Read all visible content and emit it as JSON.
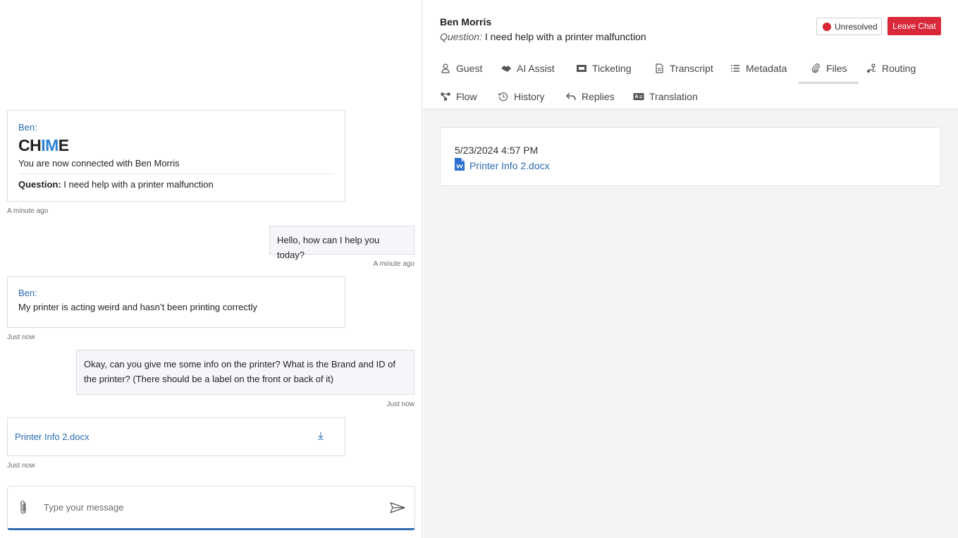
{
  "chat": {
    "connect_card": {
      "sender": "Ben:",
      "logo": {
        "pre": "CH",
        "mid": "IM",
        "post": "E"
      },
      "text": "You are now connected with Ben Morris",
      "question_label": "Question:",
      "question_text": " I need help with a printer malfunction",
      "timestamp": "A minute ago"
    },
    "msg_agent_1": {
      "text": "Hello, how can I help you today?",
      "timestamp": "A minute ago"
    },
    "msg_guest_2": {
      "sender": "Ben:",
      "text": "My printer is acting weird and hasn’t been printing correctly",
      "timestamp": "Just now"
    },
    "msg_agent_2": {
      "text": "Okay, can you give me some info on the printer? What is the Brand and ID of the printer? (There should be a label on the front or back of it)",
      "timestamp": "Just now"
    },
    "file_msg": {
      "name": "Printer Info 2.docx",
      "timestamp": "Just now"
    },
    "composer": {
      "placeholder": "Type your message"
    }
  },
  "detail": {
    "guest_name": "Ben Morris",
    "question_label": "Question:",
    "question_text": " I need help with a printer malfunction",
    "status_label": "Unresolved",
    "status_color": "#d9262f",
    "leave_label": "Leave Chat",
    "tabs": [
      {
        "label": "Guest",
        "icon": "person-icon"
      },
      {
        "label": "AI Assist",
        "icon": "handshake-icon"
      },
      {
        "label": "Ticketing",
        "icon": "ticket-icon"
      },
      {
        "label": "Transcript",
        "icon": "document-icon"
      },
      {
        "label": "Metadata",
        "icon": "list-icon"
      },
      {
        "label": "Files",
        "icon": "paperclip-icon",
        "active": true
      },
      {
        "label": "Routing",
        "icon": "routing-icon"
      },
      {
        "label": "Flow",
        "icon": "flow-icon"
      },
      {
        "label": "History",
        "icon": "history-icon"
      },
      {
        "label": "Replies",
        "icon": "reply-icon"
      },
      {
        "label": "Translation",
        "icon": "translation-icon"
      }
    ],
    "file_entry": {
      "date": "5/23/2024 4:57 PM",
      "name": "Printer Info 2.docx"
    }
  },
  "colors": {
    "accent": "#2a6ab0",
    "danger": "#d9283a",
    "logo_blue": "#2b83d6"
  }
}
